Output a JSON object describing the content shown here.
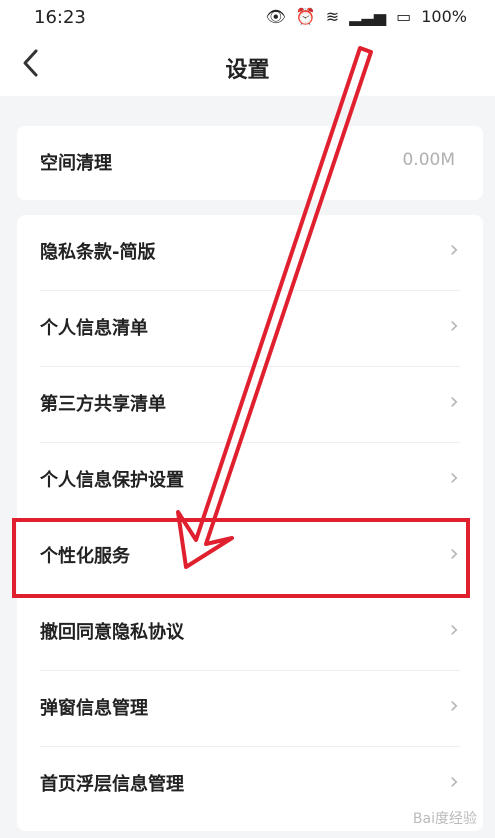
{
  "status": {
    "time": "16:23",
    "battery": "100%"
  },
  "nav": {
    "title": "设置",
    "back_label": "<"
  },
  "card1": {
    "label": "空间清理",
    "value": "0.00M"
  },
  "items": [
    {
      "label": "隐私条款-简版"
    },
    {
      "label": "个人信息清单"
    },
    {
      "label": "第三方共享清单"
    },
    {
      "label": "个人信息保护设置"
    },
    {
      "label": "个性化服务"
    },
    {
      "label": "撤回同意隐私协议"
    },
    {
      "label": "弹窗信息管理"
    },
    {
      "label": "首页浮层信息管理"
    }
  ],
  "watermark": "Bai度经验",
  "colors": {
    "highlight": "#e0202e",
    "arrow": "#e0202e"
  }
}
